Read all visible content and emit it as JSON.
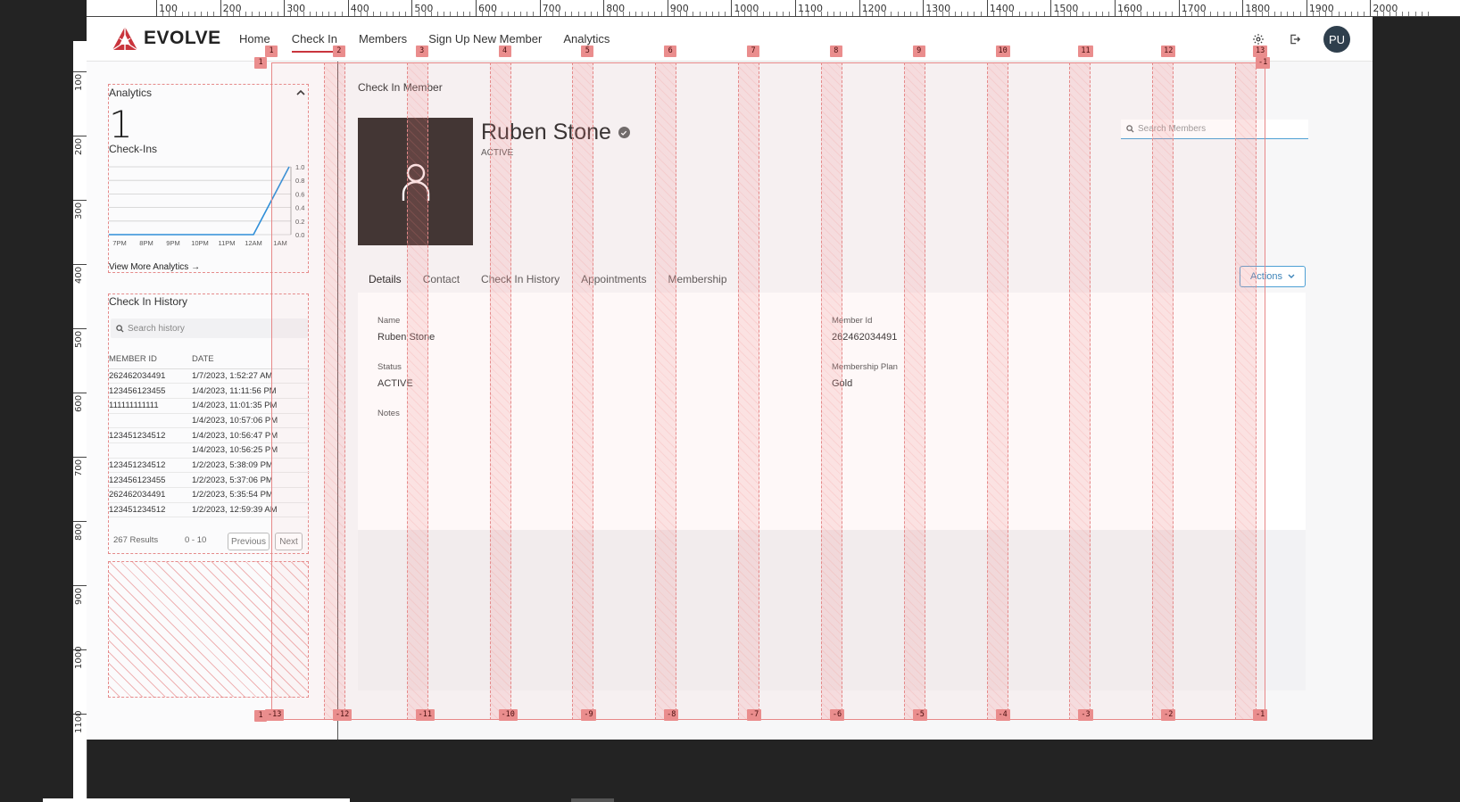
{
  "ruler": {
    "top_labels": [
      "100",
      "200",
      "300",
      "400",
      "500",
      "600",
      "700",
      "800",
      "900",
      "1000",
      "1100",
      "1200",
      "1300",
      "1400",
      "1500",
      "1600",
      "1700",
      "1800",
      "1900",
      "2000"
    ],
    "left_labels": [
      "100",
      "200",
      "300",
      "400",
      "500",
      "600",
      "700",
      "800",
      "900",
      "1000",
      "1100"
    ]
  },
  "header": {
    "brand": "EVOLVE",
    "nav": [
      {
        "label": "Home",
        "active": false
      },
      {
        "label": "Check In",
        "active": true
      },
      {
        "label": "Members",
        "active": false
      },
      {
        "label": "Sign Up New Member",
        "active": false
      },
      {
        "label": "Analytics",
        "active": false
      }
    ],
    "settings_icon": "gear-icon",
    "logout_icon": "logout-icon",
    "avatar_initials": "PU",
    "colors": {
      "accent": "#c9353d",
      "avatar_bg": "#2f3f4d"
    }
  },
  "sidebar": {
    "analytics": {
      "title": "Analytics",
      "count": "1",
      "count_label": "Check-Ins",
      "view_more": "View More Analytics",
      "chart_data": {
        "type": "line",
        "categories": [
          "7PM",
          "8PM",
          "9PM",
          "10PM",
          "11PM",
          "12AM",
          "1AM"
        ],
        "values": [
          0,
          0,
          0,
          0,
          0,
          0,
          1
        ],
        "yticks": [
          "1.0",
          "0.8",
          "0.6",
          "0.4",
          "0.2",
          "0.0"
        ],
        "ylim": [
          0,
          1
        ],
        "line_color": "#2f8fd8"
      }
    },
    "history": {
      "title": "Check In History",
      "search_placeholder": "Search history",
      "columns": [
        "MEMBER ID",
        "DATE"
      ],
      "rows": [
        [
          "262462034491",
          "1/7/2023, 1:52:27 AM"
        ],
        [
          "123456123455",
          "1/4/2023, 11:11:56 PM"
        ],
        [
          "111111111111",
          "1/4/2023, 11:01:35 PM"
        ],
        [
          "",
          "1/4/2023, 10:57:06 PM"
        ],
        [
          "123451234512",
          "1/4/2023, 10:56:47 PM"
        ],
        [
          "",
          "1/4/2023, 10:56:25 PM"
        ],
        [
          "123451234512",
          "1/2/2023, 5:38:09 PM"
        ],
        [
          "123456123455",
          "1/2/2023, 5:37:06 PM"
        ],
        [
          "262462034491",
          "1/2/2023, 5:35:54 PM"
        ],
        [
          "123451234512",
          "1/2/2023, 12:59:39 AM"
        ]
      ],
      "results": "267 Results",
      "range": "0 - 10",
      "prev": "Previous",
      "next": "Next"
    }
  },
  "main": {
    "title": "Check In Member",
    "member": {
      "name": "Ruben Stone",
      "status": "ACTIVE"
    },
    "search_placeholder": "Search Members",
    "tabs": [
      {
        "label": "Details",
        "active": true
      },
      {
        "label": "Contact",
        "active": false
      },
      {
        "label": "Check In History",
        "active": false
      },
      {
        "label": "Appointments",
        "active": false
      },
      {
        "label": "Membership",
        "active": false
      }
    ],
    "actions_label": "Actions",
    "details": {
      "name_label": "Name",
      "name_value": "Ruben Stone",
      "member_id_label": "Member Id",
      "member_id_value": "262462034491",
      "status_label": "Status",
      "status_value": "ACTIVE",
      "plan_label": "Membership Plan",
      "plan_value": "Gold",
      "notes_label": "Notes"
    }
  },
  "overlay": {
    "top_tags": [
      "1",
      "2",
      "3",
      "4",
      "5",
      "6",
      "7",
      "8",
      "9",
      "10",
      "11",
      "12",
      "13"
    ],
    "bottom_tags": [
      "-13",
      "-12",
      "-11",
      "-10",
      "-9",
      "-8",
      "-7",
      "-6",
      "-5",
      "-4",
      "-3",
      "-2",
      "-1"
    ],
    "row_tag_top": "1",
    "row_tag_right": "-1",
    "row_tag_bottom": "1"
  }
}
